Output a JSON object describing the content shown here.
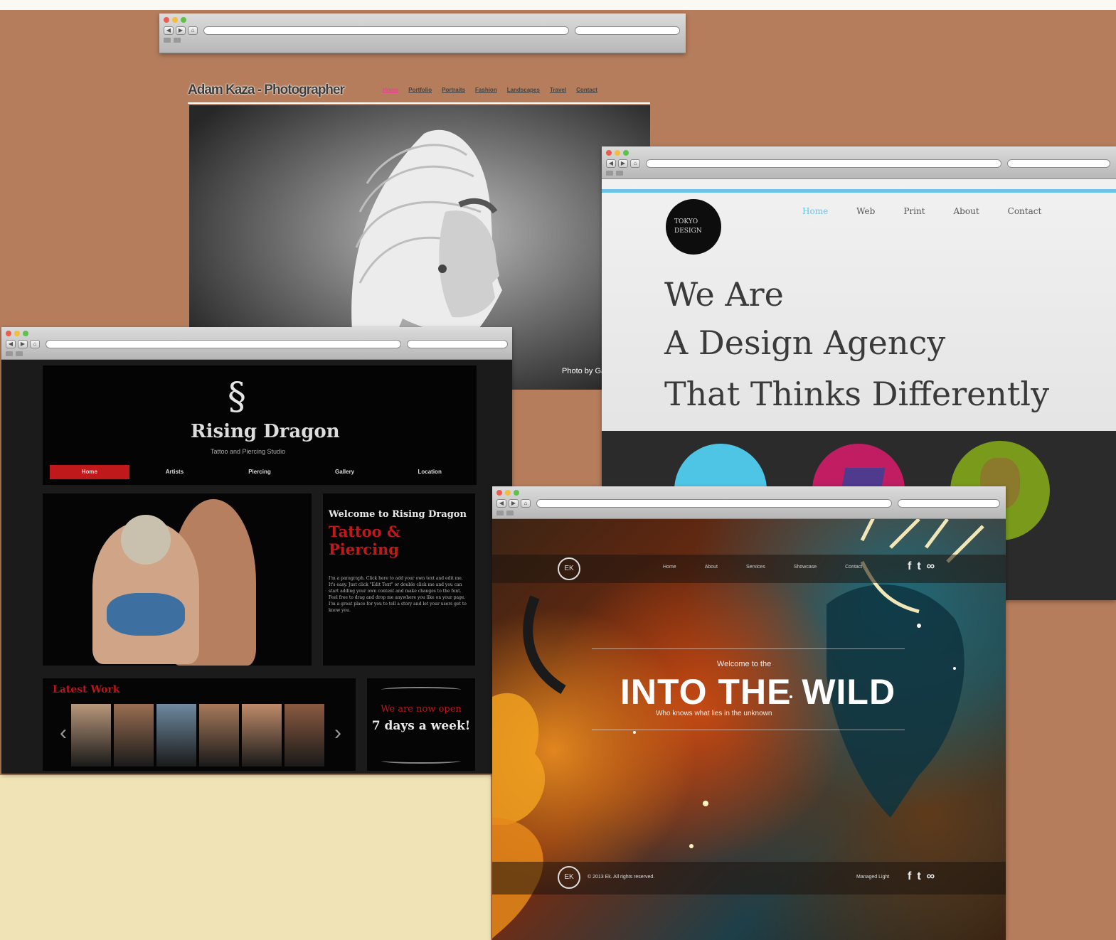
{
  "colors": {
    "backdrop": "#b57d5c",
    "cream": "#f0e4b6",
    "accent_red": "#c0191c",
    "accent_blue": "#6cc3e6"
  },
  "browser": {
    "address_placeholder": "",
    "window_buttons": [
      "close",
      "minimize",
      "zoom"
    ]
  },
  "photographer": {
    "title": "Adam Kaza - Photographer",
    "nav": [
      "Home",
      "Portfolio",
      "Portraits",
      "Fashion",
      "Landscapes",
      "Travel",
      "Contact"
    ],
    "credit": "Photo by Garnet"
  },
  "tokyo": {
    "logo": "TOKYO DESIGN",
    "nav": [
      "Home",
      "Web",
      "Print",
      "About",
      "Contact"
    ],
    "headline": [
      "We Are",
      "A Design Agency",
      "That Thinks Differently"
    ]
  },
  "dragon": {
    "logo": "Rising Dragon",
    "tagline": "Tattoo and Piercing Studio",
    "nav": [
      "Home",
      "Artists",
      "Piercing",
      "Gallery",
      "Location"
    ],
    "welcome": "Welcome to Rising Dragon",
    "welcome_sub": "Tattoo & Piercing",
    "body": "I'm a paragraph. Click here to add your own text and edit me. It's easy. Just click \"Edit Text\" or double click me and you can start adding your own content and make changes to the font. Feel free to drag and drop me anywhere you like on your page. I'm a great place for you to tell a story and let your users get to know you.",
    "latest": "Latest Work",
    "open_line1": "We are now open",
    "open_line2": "7 days a week!"
  },
  "wild": {
    "logo": "EK",
    "nav": [
      "Home",
      "About",
      "Services",
      "Showcase",
      "Contact"
    ],
    "eyebrow": "Welcome to the",
    "title": "INTO THE WILD",
    "subtitle": "Who knows what lies in the unknown",
    "footer": "© 2013 Ek. All rights reserved.",
    "footer_right": "Managed Light",
    "social": [
      "f",
      "t",
      "∞"
    ]
  }
}
